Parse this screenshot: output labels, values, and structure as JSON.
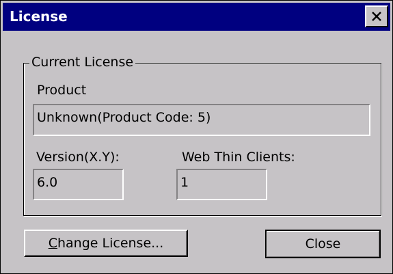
{
  "window": {
    "title": "License",
    "close_icon": "close-icon"
  },
  "group": {
    "title": "Current License"
  },
  "product": {
    "label": "Product",
    "value": "Unknown(Product Code: 5)"
  },
  "version": {
    "label": "Version(X.Y):",
    "value": "6.0"
  },
  "clients": {
    "label": "Web Thin Clients:",
    "value": "1"
  },
  "buttons": {
    "change_mnemonic": "C",
    "change_rest": "hange License...",
    "close_label": "Close"
  },
  "colors": {
    "title_bar": "#000080",
    "face": "#c6c3c6"
  }
}
